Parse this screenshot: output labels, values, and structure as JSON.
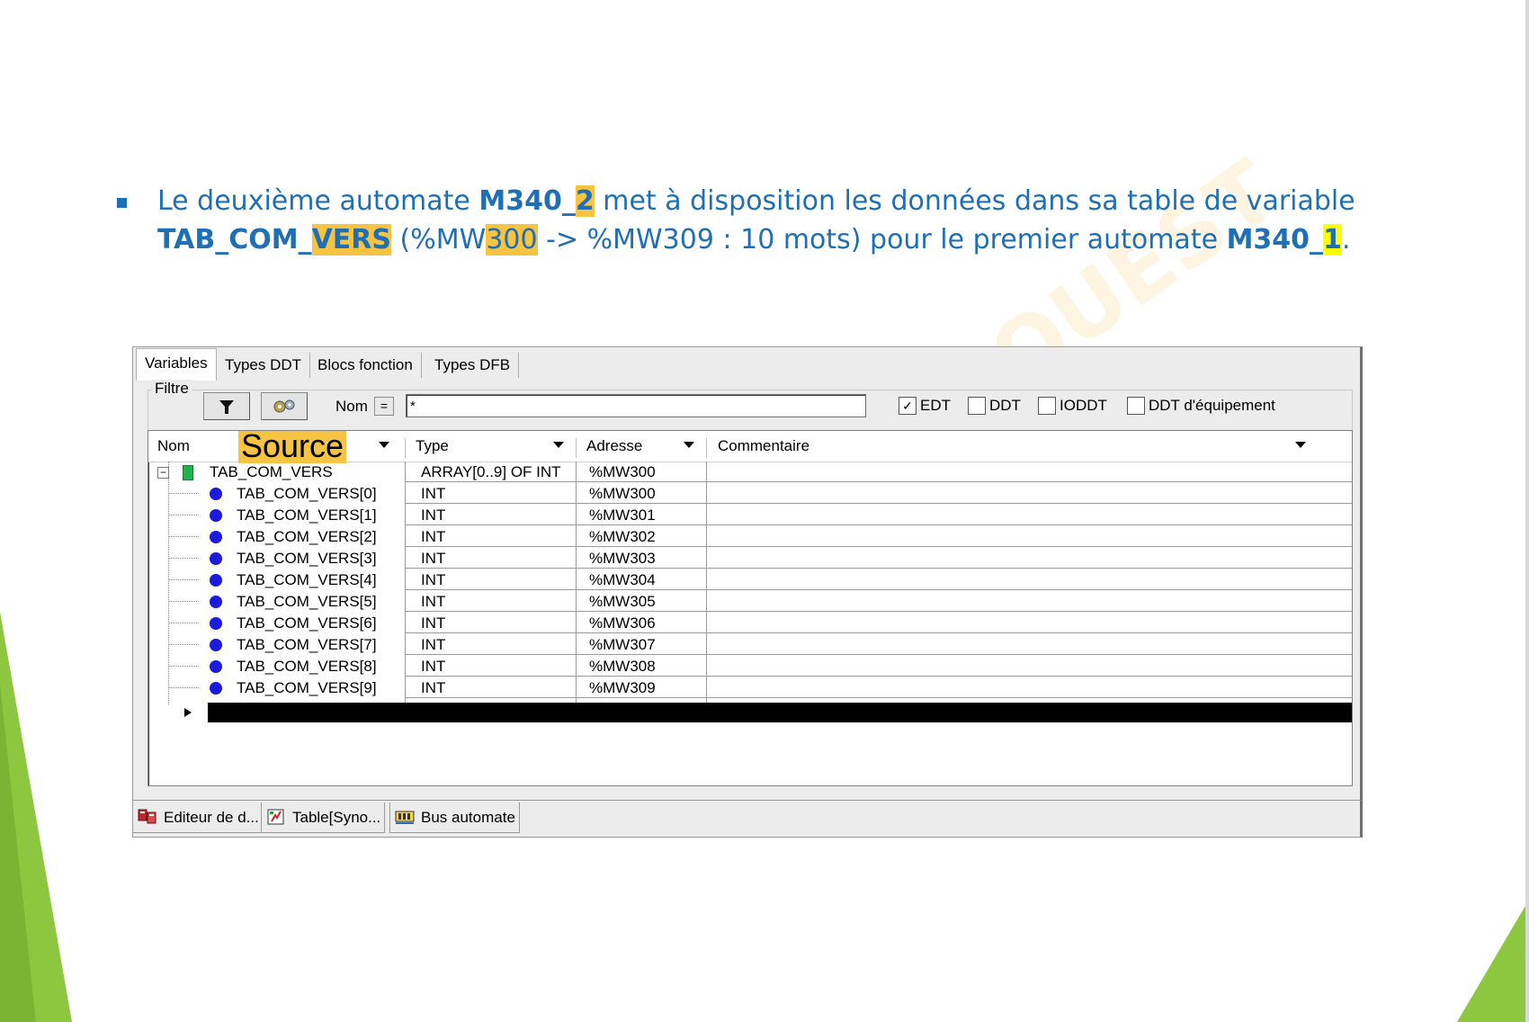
{
  "slide": {
    "watermark": "OUEST",
    "bullet": {
      "line1": {
        "t1": "Le deuxième automate ",
        "b1": "M340_",
        "b1_hl": "2",
        "t2": " met à disposition les données dans sa table de variable"
      },
      "line2": {
        "b1": "TAB_COM_",
        "b1_hl": "VERS",
        "t1": " (%MW",
        "t1_hl": "300",
        "t2": " -> %MW309 : 10 mots) pour le premier automate ",
        "b2": "M340_",
        "b2_hl": "1",
        "t3": "."
      }
    }
  },
  "app": {
    "tabs": [
      "Variables",
      "Types DDT",
      "Blocs fonction",
      "Types DFB"
    ],
    "filter": {
      "legend": "Filtre",
      "filter_icon": "funnel-icon",
      "refresh_icon": "gears-icon",
      "name_label": "Nom",
      "eq_button": "=",
      "name_value": "*",
      "checkboxes": [
        {
          "label": "EDT",
          "checked": true
        },
        {
          "label": "DDT",
          "checked": false
        },
        {
          "label": "IODDT",
          "checked": false
        },
        {
          "label": "DDT d'équipement",
          "checked": false
        }
      ]
    },
    "grid": {
      "columns": [
        "Nom",
        "Type",
        "Adresse",
        "Commentaire"
      ],
      "annotation": "Source",
      "parent": {
        "name": "TAB_COM_VERS",
        "type": "ARRAY[0..9] OF INT",
        "address": "%MW300"
      },
      "rows": [
        {
          "name": "TAB_COM_VERS[0]",
          "type": "INT",
          "address": "%MW300"
        },
        {
          "name": "TAB_COM_VERS[1]",
          "type": "INT",
          "address": "%MW301"
        },
        {
          "name": "TAB_COM_VERS[2]",
          "type": "INT",
          "address": "%MW302"
        },
        {
          "name": "TAB_COM_VERS[3]",
          "type": "INT",
          "address": "%MW303"
        },
        {
          "name": "TAB_COM_VERS[4]",
          "type": "INT",
          "address": "%MW304"
        },
        {
          "name": "TAB_COM_VERS[5]",
          "type": "INT",
          "address": "%MW305"
        },
        {
          "name": "TAB_COM_VERS[6]",
          "type": "INT",
          "address": "%MW306"
        },
        {
          "name": "TAB_COM_VERS[7]",
          "type": "INT",
          "address": "%MW307"
        },
        {
          "name": "TAB_COM_VERS[8]",
          "type": "INT",
          "address": "%MW308"
        },
        {
          "name": "TAB_COM_VERS[9]",
          "type": "INT",
          "address": "%MW309"
        }
      ]
    },
    "bottom_tabs": [
      {
        "label": "Editeur de d...",
        "icon": "data-editor-icon"
      },
      {
        "label": "Table[Syno...",
        "icon": "animation-table-icon"
      },
      {
        "label": "Bus automate",
        "icon": "plc-bus-icon"
      }
    ]
  },
  "colors": {
    "text_blue": "#1f6fb5",
    "highlight_orange": "#f6c343",
    "highlight_yellow": "#ffff00",
    "green": "#8dc63f",
    "dot_blue": "#1b1bdc"
  }
}
